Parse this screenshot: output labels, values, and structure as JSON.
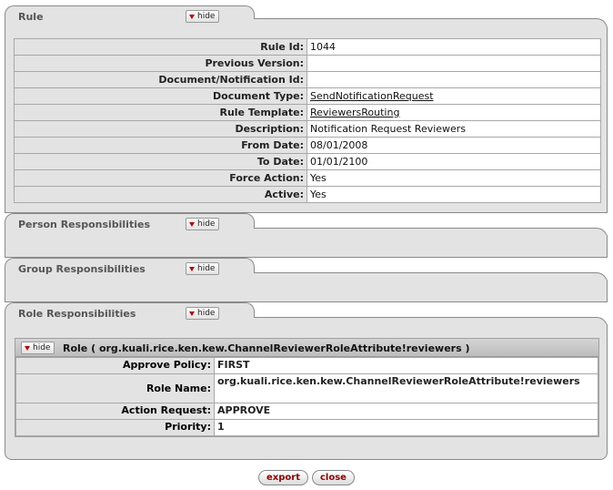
{
  "rule_section": {
    "title": "Rule",
    "hide_label": "hide",
    "fields": [
      {
        "label": "Rule Id:",
        "value": "1044",
        "link": false
      },
      {
        "label": "Previous Version:",
        "value": "",
        "link": false
      },
      {
        "label": "Document/Notification Id:",
        "value": "",
        "link": false
      },
      {
        "label": "Document Type:",
        "value": "SendNotificationRequest",
        "link": true
      },
      {
        "label": "Rule Template:",
        "value": "ReviewersRouting",
        "link": true
      },
      {
        "label": "Description:",
        "value": "Notification Request Reviewers",
        "link": false
      },
      {
        "label": "From Date:",
        "value": "08/01/2008",
        "link": false
      },
      {
        "label": "To Date:",
        "value": "01/01/2100",
        "link": false
      },
      {
        "label": "Force Action:",
        "value": "Yes",
        "link": false
      },
      {
        "label": "Active:",
        "value": "Yes",
        "link": false
      }
    ]
  },
  "person_section": {
    "title": "Person Responsibilities",
    "hide_label": "hide"
  },
  "group_section": {
    "title": "Group Responsibilities",
    "hide_label": "hide"
  },
  "role_section": {
    "title": "Role Responsibilities",
    "hide_label": "hide",
    "role": {
      "hide_label": "hide",
      "title": "Role ( org.kuali.rice.ken.kew.ChannelReviewerRoleAttribute!reviewers )",
      "fields": [
        {
          "label": "Approve Policy:",
          "value": "FIRST"
        },
        {
          "label": "Role Name:",
          "value": "org.kuali.rice.ken.kew.ChannelReviewerRoleAttribute!reviewers"
        },
        {
          "label": "Action Request:",
          "value": "APPROVE"
        },
        {
          "label": "Priority:",
          "value": "1"
        }
      ]
    }
  },
  "buttons": {
    "export": "export",
    "close": "close"
  },
  "colors": {
    "panel": "#e3e3e3",
    "border": "#8a8a8a",
    "hide_arrow": "#b40000",
    "button_text": "#8b0000"
  }
}
